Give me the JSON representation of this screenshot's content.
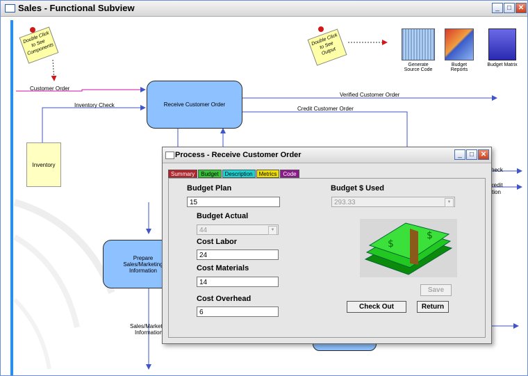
{
  "window": {
    "title": "Sales - Functional Subview"
  },
  "notes": {
    "left": {
      "line1": "Double Click",
      "line2": "to See",
      "line3": "Components"
    },
    "right": {
      "line1": "Double Click",
      "line2": "to See",
      "line3": "Output"
    }
  },
  "toolbar": {
    "generate": "Generate Source Code",
    "reports": "Budget Reports",
    "matrix": "Budget Matrix"
  },
  "diagram": {
    "receive": "Receive Customer Order",
    "prepare": "Prepare Sales/Marketing Information",
    "inventory": "Inventory",
    "customer_order": "Customer Order",
    "inventory_check": "Inventory Check",
    "verified": "Verified Customer Order",
    "credit": "Credit Customer Order",
    "check_partial": "heck",
    "credit_partial_1": "redit",
    "credit_partial_2": "tion",
    "sales_info_1": "Sales/Marketi",
    "sales_info_2": "Information"
  },
  "dialog": {
    "title": "Process - Receive Customer Order",
    "tabs": [
      {
        "label": "Summary",
        "color": "#b4242a"
      },
      {
        "label": "Budget",
        "color": "#34c434"
      },
      {
        "label": "Description",
        "color": "#18d4d4"
      },
      {
        "label": "Metrics",
        "color": "#f0e000"
      },
      {
        "label": "Code",
        "color": "#8a1a8a"
      }
    ],
    "budget_plan_label": "Budget Plan",
    "budget_plan_value": "15",
    "budget_used_label": "Budget $ Used",
    "budget_used_value": "293.33",
    "budget_actual_label": "Budget Actual",
    "budget_actual_value": "44",
    "cost_labor_label": "Cost Labor",
    "cost_labor_value": "24",
    "cost_materials_label": "Cost Materials",
    "cost_materials_value": "14",
    "cost_overhead_label": "Cost Overhead",
    "cost_overhead_value": "6",
    "save_label": "Save",
    "checkout_label": "Check Out",
    "return_label": "Return"
  },
  "colors": {
    "accent": "#1e90ff",
    "process_fill": "#8ec1ff",
    "note_fill": "#ffffa8"
  }
}
